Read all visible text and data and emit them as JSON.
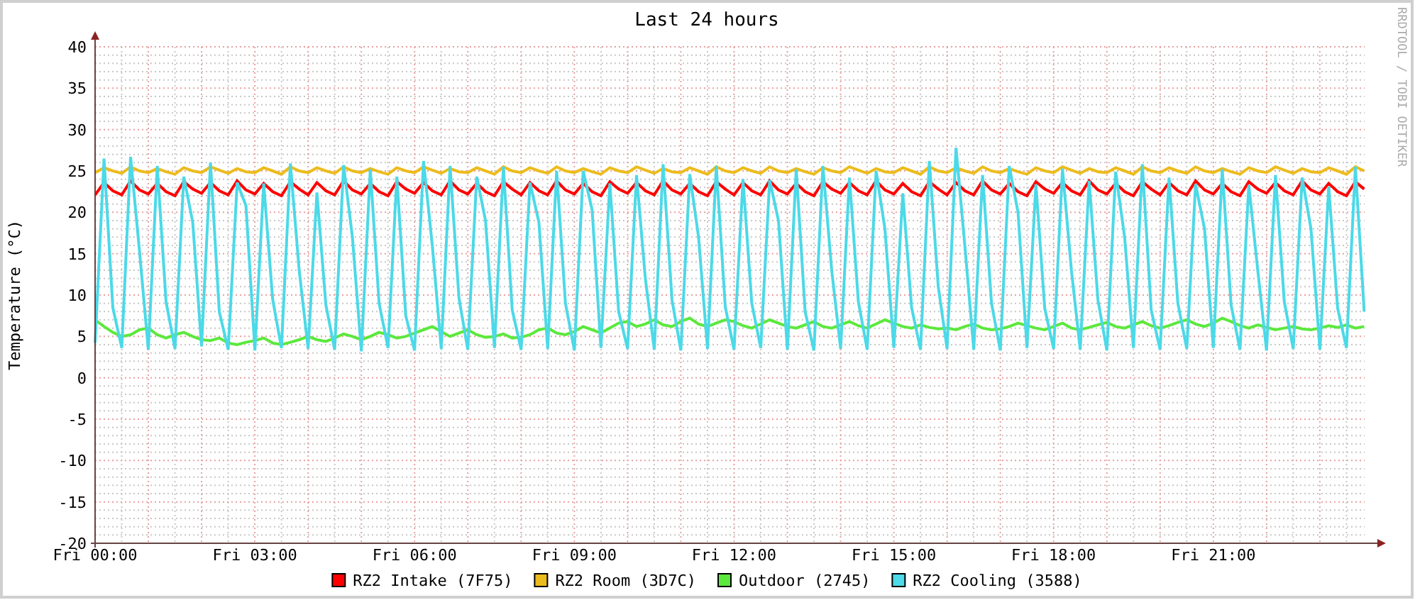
{
  "chart_data": {
    "type": "line",
    "title": "Last 24 hours",
    "ylabel": "Temperature (°C)",
    "ylim": [
      -20,
      40
    ],
    "grid": true,
    "legend": "bottom",
    "yticks": [
      -20,
      -15,
      -10,
      -5,
      0,
      5,
      10,
      15,
      20,
      25,
      30,
      35,
      40
    ],
    "categories": [
      "Fri 00:00",
      null,
      null,
      null,
      null,
      null,
      null,
      null,
      null,
      null,
      null,
      null,
      null,
      null,
      null,
      null,
      null,
      null,
      "Fri 03:00",
      null,
      null,
      null,
      null,
      null,
      null,
      null,
      null,
      null,
      null,
      null,
      null,
      null,
      null,
      null,
      null,
      null,
      "Fri 06:00",
      null,
      null,
      null,
      null,
      null,
      null,
      null,
      null,
      null,
      null,
      null,
      null,
      null,
      null,
      null,
      null,
      null,
      "Fri 09:00",
      null,
      null,
      null,
      null,
      null,
      null,
      null,
      null,
      null,
      null,
      null,
      null,
      null,
      null,
      null,
      null,
      null,
      "Fri 12:00",
      null,
      null,
      null,
      null,
      null,
      null,
      null,
      null,
      null,
      null,
      null,
      null,
      null,
      null,
      null,
      null,
      null,
      "Fri 15:00",
      null,
      null,
      null,
      null,
      null,
      null,
      null,
      null,
      null,
      null,
      null,
      null,
      null,
      null,
      null,
      null,
      null,
      "Fri 18:00",
      null,
      null,
      null,
      null,
      null,
      null,
      null,
      null,
      null,
      null,
      null,
      null,
      null,
      null,
      null,
      null,
      null,
      "Fri 21:00",
      null,
      null,
      null,
      null,
      null,
      null,
      null,
      null,
      null,
      null,
      null,
      null,
      null,
      null,
      null,
      null,
      null
    ],
    "series": [
      {
        "name": "RZ2 Intake (7F75)",
        "color": "#ff0000",
        "values": [
          22.1,
          23.6,
          22.6,
          22.1,
          23.8,
          22.7,
          22.2,
          23.5,
          22.5,
          22.0,
          23.7,
          22.8,
          22.3,
          23.6,
          22.6,
          22.1,
          23.8,
          22.7,
          22.2,
          23.5,
          22.5,
          22.0,
          23.7,
          22.8,
          22.1,
          23.6,
          22.6,
          22.1,
          23.8,
          22.7,
          22.2,
          23.5,
          22.5,
          22.0,
          23.7,
          22.8,
          22.3,
          23.6,
          22.6,
          22.1,
          23.8,
          22.7,
          22.2,
          23.5,
          22.5,
          22.0,
          23.7,
          22.8,
          22.1,
          23.6,
          22.6,
          22.1,
          23.8,
          22.7,
          22.2,
          23.5,
          22.5,
          22.0,
          23.7,
          22.8,
          22.3,
          23.6,
          22.6,
          22.1,
          23.8,
          22.7,
          22.2,
          23.5,
          22.5,
          22.0,
          23.7,
          22.8,
          22.1,
          23.6,
          22.6,
          22.1,
          23.8,
          22.7,
          22.2,
          23.5,
          22.5,
          22.0,
          23.7,
          22.8,
          22.3,
          23.6,
          22.6,
          22.1,
          23.8,
          22.7,
          22.2,
          23.5,
          22.5,
          22.0,
          23.7,
          22.8,
          22.1,
          23.6,
          22.6,
          22.1,
          23.8,
          22.7,
          22.2,
          23.5,
          22.5,
          22.0,
          23.7,
          22.8,
          22.3,
          23.6,
          22.6,
          22.1,
          23.8,
          22.7,
          22.2,
          23.5,
          22.5,
          22.0,
          23.7,
          22.8,
          22.1,
          23.6,
          22.6,
          22.1,
          23.8,
          22.7,
          22.2,
          23.5,
          22.5,
          22.0,
          23.7,
          22.8,
          22.3,
          23.6,
          22.6,
          22.1,
          23.8,
          22.7,
          22.2,
          23.5,
          22.5,
          22.0,
          23.7,
          22.8
        ]
      },
      {
        "name": "RZ2 Room (3D7C)",
        "color": "#ecbc1c",
        "values": [
          24.8,
          25.4,
          25.0,
          24.7,
          25.5,
          25.0,
          24.8,
          25.3,
          24.9,
          24.6,
          25.4,
          25.0,
          24.8,
          25.5,
          25.1,
          24.7,
          25.3,
          24.9,
          24.8,
          25.4,
          25.0,
          24.6,
          25.5,
          25.0,
          24.8,
          25.4,
          25.0,
          24.7,
          25.5,
          25.0,
          24.8,
          25.3,
          24.9,
          24.6,
          25.4,
          25.0,
          24.8,
          25.5,
          25.1,
          24.7,
          25.3,
          24.9,
          24.8,
          25.4,
          25.0,
          24.6,
          25.5,
          25.0,
          24.8,
          25.4,
          25.0,
          24.7,
          25.5,
          25.0,
          24.8,
          25.3,
          24.9,
          24.6,
          25.4,
          25.0,
          24.8,
          25.5,
          25.1,
          24.7,
          25.3,
          24.9,
          24.8,
          25.4,
          25.0,
          24.6,
          25.5,
          25.0,
          24.8,
          25.4,
          25.0,
          24.7,
          25.5,
          25.0,
          24.8,
          25.3,
          24.9,
          24.6,
          25.4,
          25.0,
          24.8,
          25.5,
          25.1,
          24.7,
          25.3,
          24.9,
          24.8,
          25.4,
          25.0,
          24.6,
          25.5,
          25.0,
          24.8,
          25.4,
          25.0,
          24.7,
          25.5,
          25.0,
          24.8,
          25.3,
          24.9,
          24.6,
          25.4,
          25.0,
          24.8,
          25.5,
          25.1,
          24.7,
          25.3,
          24.9,
          24.8,
          25.4,
          25.0,
          24.6,
          25.5,
          25.0,
          24.8,
          25.4,
          25.0,
          24.7,
          25.5,
          25.0,
          24.8,
          25.3,
          24.9,
          24.6,
          25.4,
          25.0,
          24.8,
          25.5,
          25.1,
          24.7,
          25.3,
          24.9,
          24.8,
          25.4,
          25.0,
          24.6,
          25.5,
          25.0
        ]
      },
      {
        "name": "Outdoor (2745)",
        "color": "#5ce83c",
        "values": [
          7.0,
          6.2,
          5.5,
          5.0,
          5.2,
          5.8,
          6.0,
          5.2,
          4.8,
          5.2,
          5.5,
          5.0,
          4.6,
          4.5,
          4.8,
          4.2,
          4.0,
          4.3,
          4.5,
          4.8,
          4.2,
          4.0,
          4.3,
          4.6,
          5.0,
          4.6,
          4.4,
          4.8,
          5.3,
          5.0,
          4.6,
          5.0,
          5.5,
          5.2,
          4.8,
          5.0,
          5.4,
          5.8,
          6.2,
          5.6,
          5.0,
          5.4,
          5.8,
          5.2,
          4.9,
          5.0,
          5.3,
          4.8,
          4.9,
          5.2,
          5.8,
          6.0,
          5.4,
          5.2,
          5.6,
          6.2,
          5.8,
          5.4,
          6.0,
          6.6,
          6.8,
          6.2,
          6.5,
          7.0,
          6.4,
          6.2,
          6.8,
          7.2,
          6.5,
          6.2,
          6.6,
          7.0,
          6.8,
          6.3,
          6.0,
          6.5,
          7.0,
          6.6,
          6.2,
          6.0,
          6.4,
          6.8,
          6.2,
          6.0,
          6.4,
          6.8,
          6.3,
          6.0,
          6.5,
          7.0,
          6.6,
          6.2,
          6.0,
          6.4,
          6.1,
          5.9,
          6.0,
          5.8,
          6.2,
          6.5,
          6.0,
          5.8,
          5.9,
          6.2,
          6.6,
          6.3,
          6.0,
          5.8,
          6.2,
          6.6,
          6.0,
          5.8,
          6.1,
          6.4,
          6.7,
          6.2,
          6.0,
          6.4,
          6.8,
          6.3,
          6.0,
          6.3,
          6.7,
          7.0,
          6.5,
          6.2,
          6.6,
          7.2,
          6.8,
          6.3,
          6.0,
          6.4,
          6.1,
          5.8,
          6.0,
          6.2,
          5.9,
          5.8,
          6.0,
          6.3,
          6.1,
          6.4,
          6.0,
          6.2
        ]
      },
      {
        "name": "RZ2 Cooling (3588)",
        "color": "#4cd9e8",
        "values": [
          4.2,
          26.5,
          8.5,
          3.6,
          26.7,
          15.3,
          3.4,
          25.6,
          9.2,
          3.5,
          24.3,
          18.8,
          3.8,
          26.0,
          8.0,
          3.4,
          23.6,
          20.8,
          3.3,
          23.5,
          9.5,
          3.6,
          25.9,
          13.0,
          3.5,
          22.4,
          8.8,
          3.4,
          25.7,
          17.0,
          3.2,
          25.2,
          9.0,
          3.6,
          24.3,
          7.5,
          3.3,
          26.2,
          16.0,
          3.5,
          25.6,
          9.6,
          3.4,
          24.3,
          19.0,
          3.6,
          25.5,
          8.2,
          3.4,
          23.6,
          18.8,
          3.5,
          25.0,
          9.0,
          3.3,
          25.0,
          20.3,
          3.6,
          23.5,
          8.0,
          3.5,
          24.5,
          12.0,
          3.4,
          25.8,
          9.4,
          3.3,
          24.6,
          17.0,
          3.5,
          25.6,
          8.6,
          3.4,
          24.0,
          9.0,
          3.6,
          23.9,
          19.0,
          3.4,
          25.2,
          8.0,
          3.3,
          25.6,
          13.0,
          3.5,
          24.2,
          9.2,
          3.4,
          25.0,
          18.0,
          3.6,
          22.3,
          8.5,
          3.4,
          26.2,
          11.0,
          3.5,
          27.8,
          16.0,
          3.4,
          24.5,
          9.0,
          3.3,
          25.6,
          20.0,
          3.6,
          23.4,
          8.4,
          3.5,
          25.3,
          13.0,
          3.4,
          23.8,
          9.4,
          3.3,
          24.9,
          17.0,
          3.6,
          25.8,
          8.2,
          3.4,
          24.2,
          9.0,
          3.5,
          23.4,
          18.0,
          3.6,
          25.2,
          8.8,
          3.4,
          23.3,
          13.0,
          3.3,
          24.5,
          9.2,
          3.5,
          24.2,
          18.0,
          3.4,
          23.1,
          8.4,
          3.6,
          25.5,
          8.0
        ]
      }
    ]
  },
  "side_text": "RRDTOOL / TOBI OETIKER"
}
